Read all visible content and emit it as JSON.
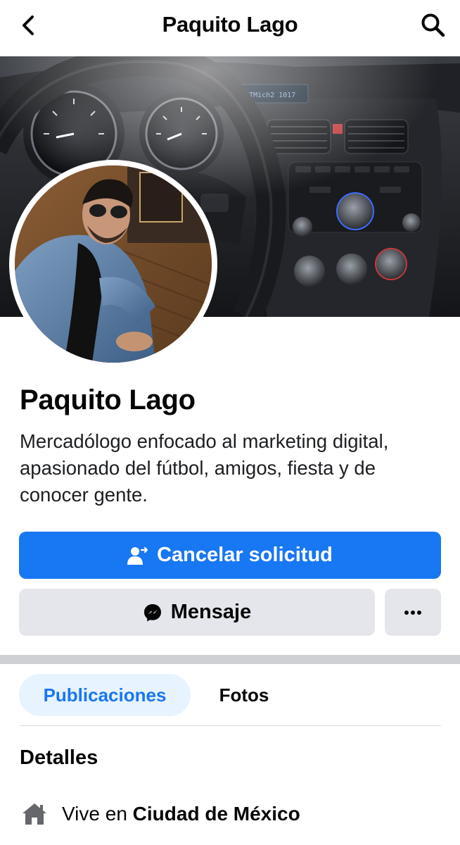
{
  "nav": {
    "title": "Paquito Lago"
  },
  "profile": {
    "name": "Paquito Lago",
    "bio": "Mercadólogo enfocado al marketing digital, apasionado del fútbol, amigos, fiesta y de conocer gente."
  },
  "actions": {
    "primary_label": "Cancelar solicitud",
    "message_label": "Mensaje",
    "more_label": "···"
  },
  "tabs": [
    {
      "label": "Publicaciones",
      "active": true
    },
    {
      "label": "Fotos",
      "active": false
    }
  ],
  "details": {
    "heading": "Detalles",
    "lives_prefix": "Vive en",
    "lives_place": "Ciudad de México"
  },
  "icons": {
    "back": "chevron-left-icon",
    "search": "search-icon",
    "request": "person-arrow-icon",
    "messenger": "messenger-icon",
    "more": "ellipsis-icon",
    "home": "home-icon"
  },
  "colors": {
    "brand": "#1877f2",
    "secondary_button": "#e4e6eb",
    "active_tab_bg": "#e7f3ff",
    "divider": "#ced0d4"
  }
}
